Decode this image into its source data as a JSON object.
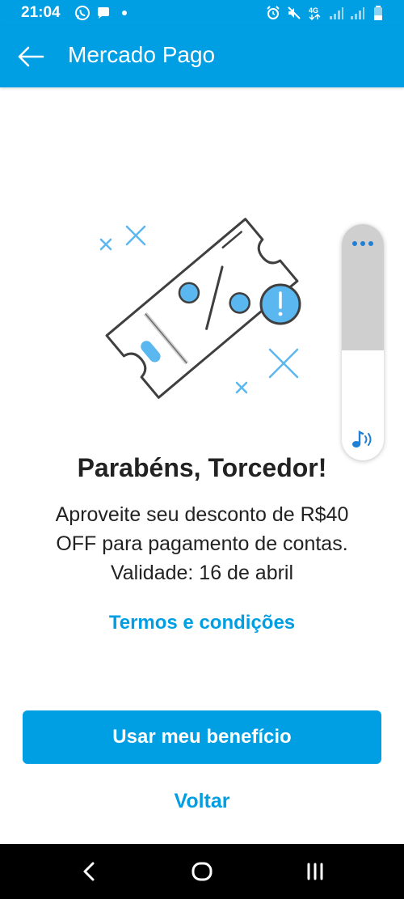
{
  "status_bar": {
    "time": "21:04",
    "left_icons": [
      "whatsapp-icon",
      "chat-bubble-icon",
      "dot-icon"
    ],
    "right_icons": [
      "alarm-icon",
      "mute-icon",
      "network-4g-icon",
      "signal-icon",
      "signal-icon",
      "battery-icon"
    ],
    "network_label": "4G"
  },
  "app_bar": {
    "title": "Mercado Pago",
    "back_icon": "arrow-left-icon"
  },
  "illustration": {
    "icon": "discount-ticket-icon",
    "alert_icon": "exclamation-icon"
  },
  "content": {
    "headline": "Parabéns, Torcedor!",
    "body_line_1": "Aproveite seu desconto de R$40",
    "body_line_2": "OFF para pagamento de contas.",
    "body_line_3": "Validade: 16 de abril",
    "terms_link": "Termos e condições"
  },
  "actions": {
    "primary_label": "Usar meu benefício",
    "secondary_label": "Voltar"
  },
  "volume_widget": {
    "more_icon": "more-dots-icon",
    "sound_icon": "music-note-icon",
    "level": 0.5
  },
  "nav_bar": {
    "back_icon": "nav-back-icon",
    "home_icon": "nav-home-icon",
    "recents_icon": "nav-recents-icon"
  },
  "colors": {
    "brand_blue": "#009ee3",
    "text_dark": "#222222",
    "accent_light_blue": "#5bb7f0"
  }
}
